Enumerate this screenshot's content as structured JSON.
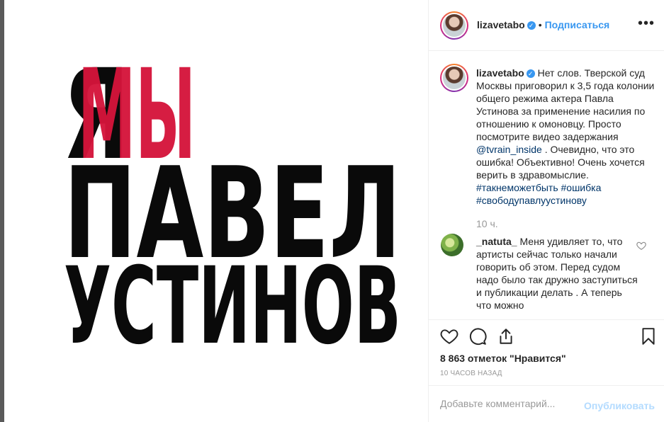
{
  "poster": {
    "line1_black": "Я",
    "line1_red": "МЫ",
    "line2": "ПАВЕЛ",
    "line3": "УСТИНОВ",
    "colors": {
      "red": "#d4143a",
      "black": "#0a0a0a"
    }
  },
  "header": {
    "username": "lizavetabo",
    "verified_icon": "verified-badge-icon",
    "separator": "•",
    "follow_label": "Подписаться",
    "more_icon": "more-options-icon",
    "more_label": "•••"
  },
  "caption": {
    "username": "lizavetabo",
    "text_part1": "Нет слов. Тверской суд Москвы приговорил к 3,5 года колонии общего режима актера Павла Устинова за применение насилия по отношению к омоновцу. Просто посмотрите видео задержания",
    "mention": "@tvrain_inside",
    "text_part2": ". Очевидно, что это ошибка! Объективно! Очень хочется верить в здравомыслие.",
    "hashtag1": "#такнеможетбыть",
    "hashtag2": "#ошибка",
    "hashtag3": "#свободупавлуустинову",
    "time": "10 ч."
  },
  "comment": {
    "username": "_natuta_",
    "text": "Меня удивляет то, что артисты сейчас только начали говорить об этом. Перед судом надо было так дружно заступиться и публикации делать . А теперь что можно"
  },
  "actions": {
    "like_icon": "heart-icon",
    "comment_icon": "comment-icon",
    "share_icon": "share-icon",
    "save_icon": "bookmark-icon",
    "likes_text": "8 863 отметок \"Нравится\"",
    "ago": "10 ЧАСОВ НАЗАД"
  },
  "add_comment": {
    "placeholder": "Добавьте комментарий...",
    "publish_label": "Опубликовать"
  }
}
